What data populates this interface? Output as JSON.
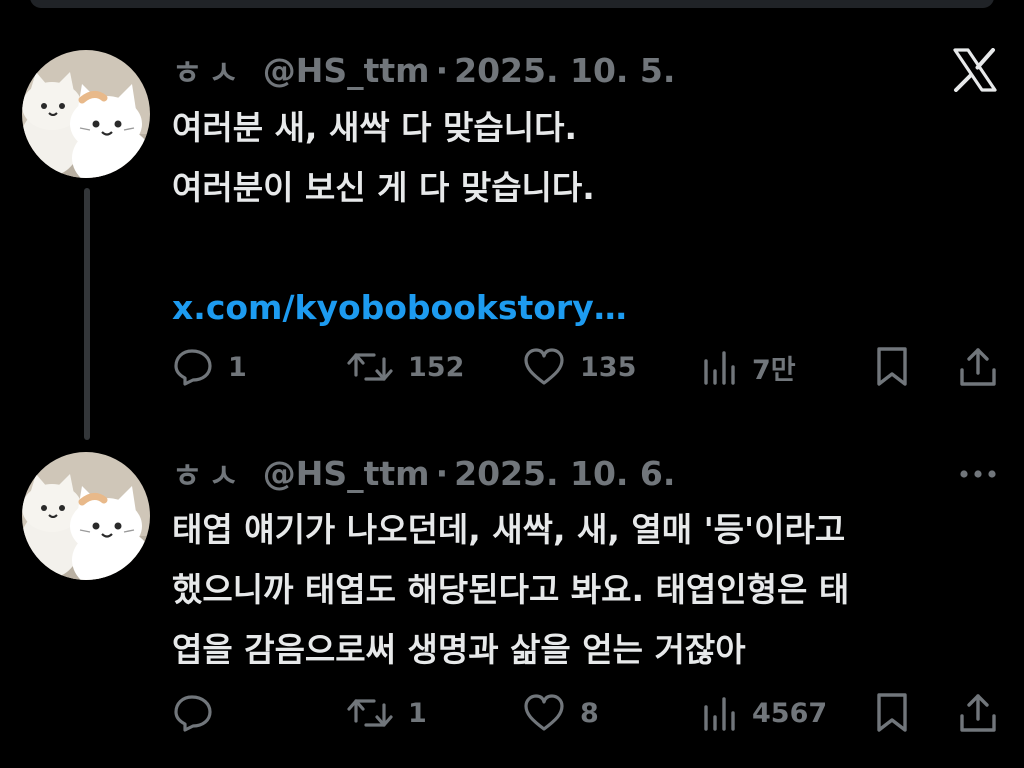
{
  "header": {
    "logo_icon": "x-logo-icon"
  },
  "colors": {
    "background": "#000000",
    "text_primary": "#e7e9ea",
    "text_secondary": "#71767b",
    "link": "#1d9bf0",
    "thread_line": "#333639"
  },
  "posts": [
    {
      "author": {
        "display_name": "ㅎㅅ",
        "handle": "@HS_ttm",
        "avatar_icon": "avatar-cat-plush-icon"
      },
      "separator": "·",
      "date": "2025. 10. 5.",
      "lines": [
        "여러분 새, 새싹 다 맞습니다.",
        "여러분이 보신 게 다 맞습니다."
      ],
      "link": "x.com/kyobobookstory…",
      "actions": {
        "reply": "1",
        "repost": "152",
        "like": "135",
        "views": "7만"
      }
    },
    {
      "author": {
        "display_name": "ㅎㅅ",
        "handle": "@HS_ttm",
        "avatar_icon": "avatar-cat-plush-icon"
      },
      "separator": "·",
      "date": "2025. 10. 6.",
      "lines": [
        "태엽 얘기가 나오던데, 새싹, 새, 열매 '등'이라고",
        "했으니까 태엽도 해당된다고 봐요. 태엽인형은 태",
        "엽을 감음으로써 생명과 삶을 얻는 거잖아"
      ],
      "link": "",
      "actions": {
        "reply": "",
        "repost": "1",
        "like": "8",
        "views": "4567"
      }
    }
  ]
}
